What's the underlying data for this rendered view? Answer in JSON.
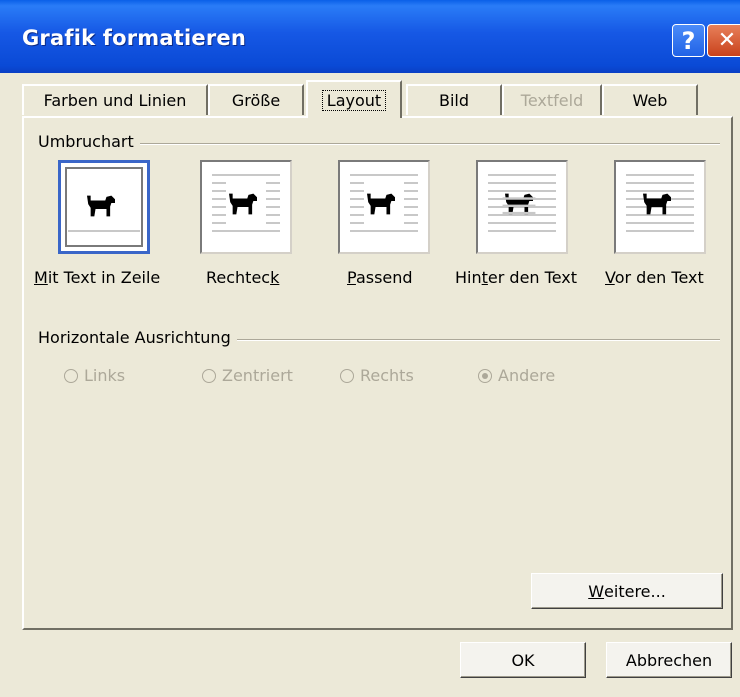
{
  "window": {
    "title": "Grafik formatieren",
    "help_glyph": "?",
    "close_glyph": "✕"
  },
  "tabs": [
    {
      "label": "Farben und Linien",
      "state": "normal"
    },
    {
      "label": "Größe",
      "state": "normal"
    },
    {
      "label": "Layout",
      "state": "active"
    },
    {
      "label": "Bild",
      "state": "normal"
    },
    {
      "label": "Textfeld",
      "state": "disabled"
    },
    {
      "label": "Web",
      "state": "normal"
    }
  ],
  "wrap": {
    "group_label": "Umbruchart",
    "options": [
      {
        "label_pre": "",
        "label_key": "M",
        "label_post": "it Text in Zeile",
        "selected": true
      },
      {
        "label_pre": "Rechtec",
        "label_key": "k",
        "label_post": "",
        "selected": false
      },
      {
        "label_pre": "",
        "label_key": "P",
        "label_post": "assend",
        "selected": false
      },
      {
        "label_pre": "Hin",
        "label_key": "t",
        "label_post": "er den Text",
        "selected": false
      },
      {
        "label_pre": "",
        "label_key": "V",
        "label_post": "or den Text",
        "selected": false
      }
    ]
  },
  "horizontal": {
    "group_label": "Horizontale Ausrichtung",
    "options": [
      {
        "label": "Links",
        "checked": false
      },
      {
        "label": "Zentriert",
        "checked": false
      },
      {
        "label": "Rechts",
        "checked": false
      },
      {
        "label": "Andere",
        "checked": true
      }
    ]
  },
  "buttons": {
    "more_key": "W",
    "more_rest": "eitere...",
    "ok": "OK",
    "cancel": "Abbrechen"
  },
  "colors": {
    "titlebar": "#0a4ad6",
    "dialog_bg": "#ece9d8",
    "selection": "#3a66c8",
    "disabled_text": "#aca899"
  }
}
